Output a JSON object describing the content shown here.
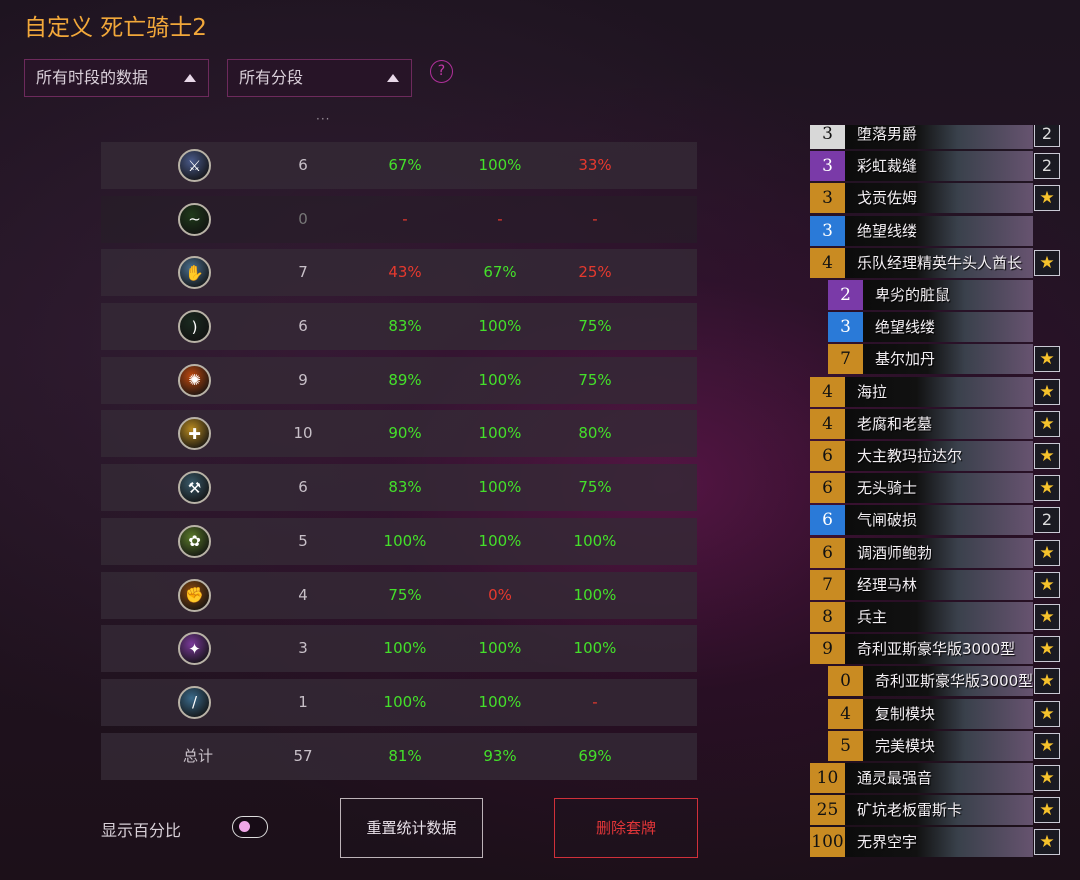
{
  "title": "自定义 死亡骑士2",
  "filters": {
    "time_label": "所有时段的数据",
    "rank_label": "所有分段",
    "help_label": "?"
  },
  "ellipsis": "···",
  "rows": [
    {
      "icon": "crossed-swords-icon",
      "games": "6",
      "w1": "67%",
      "w2": "100%",
      "w3": "33%",
      "c1": "green",
      "c2": "green",
      "c3": "red",
      "icolor": "#4a5a8a"
    },
    {
      "icon": "green-serpent-icon",
      "games": "0",
      "w1": "-",
      "w2": "-",
      "w3": "-",
      "c1": "red",
      "c2": "red",
      "c3": "red",
      "icolor": "#1f3a1a",
      "empty": true
    },
    {
      "icon": "claw-icon",
      "games": "7",
      "w1": "43%",
      "w2": "67%",
      "w3": "25%",
      "c1": "red",
      "c2": "green",
      "c3": "red",
      "icolor": "#4a7090"
    },
    {
      "icon": "bow-icon",
      "games": "6",
      "w1": "83%",
      "w2": "100%",
      "w3": "75%",
      "c1": "green",
      "c2": "green",
      "c3": "green",
      "icolor": "#1a2a20"
    },
    {
      "icon": "fire-icon",
      "games": "9",
      "w1": "89%",
      "w2": "100%",
      "w3": "75%",
      "c1": "green",
      "c2": "green",
      "c3": "green",
      "icolor": "#c04a10"
    },
    {
      "icon": "holy-tome-icon",
      "games": "10",
      "w1": "90%",
      "w2": "100%",
      "w3": "80%",
      "c1": "green",
      "c2": "green",
      "c3": "green",
      "icolor": "#b88a20"
    },
    {
      "icon": "hammer-icon",
      "games": "6",
      "w1": "83%",
      "w2": "100%",
      "w3": "75%",
      "c1": "green",
      "c2": "green",
      "c3": "green",
      "icolor": "#3a5a6a"
    },
    {
      "icon": "nature-icon",
      "games": "5",
      "w1": "100%",
      "w2": "100%",
      "w3": "100%",
      "c1": "green",
      "c2": "green",
      "c3": "green",
      "icolor": "#5a7a2a"
    },
    {
      "icon": "orc-fist-icon",
      "games": "4",
      "w1": "75%",
      "w2": "0%",
      "w3": "100%",
      "c1": "green",
      "c2": "red",
      "c3": "green",
      "icolor": "#8a4a10"
    },
    {
      "icon": "arcane-icon",
      "games": "3",
      "w1": "100%",
      "w2": "100%",
      "w3": "100%",
      "c1": "green",
      "c2": "green",
      "c3": "green",
      "icolor": "#7a3a9a"
    },
    {
      "icon": "sword-icon",
      "games": "1",
      "w1": "100%",
      "w2": "100%",
      "w3": "-",
      "c1": "green",
      "c2": "green",
      "c3": "red",
      "icolor": "#3a6a8a"
    }
  ],
  "total": {
    "label": "总计",
    "games": "57",
    "w1": "81%",
    "w2": "93%",
    "w3": "69%"
  },
  "bottom": {
    "show_percent_label": "显示百分比",
    "reset_label": "重置统计数据",
    "delete_label": "删除套牌"
  },
  "cards": [
    {
      "cost": "3",
      "name": "堕落男爵",
      "badge": "2",
      "ccolor": "white",
      "sub": false
    },
    {
      "cost": "3",
      "name": "彩虹裁缝",
      "badge": "2",
      "ccolor": "purple",
      "sub": false
    },
    {
      "cost": "3",
      "name": "戈贡佐姆",
      "badge": "★",
      "ccolor": "gold",
      "sub": false
    },
    {
      "cost": "3",
      "name": "绝望线缕",
      "badge": "",
      "ccolor": "blue",
      "sub": false
    },
    {
      "cost": "4",
      "name": "乐队经理精英牛头人酋长",
      "badge": "★",
      "ccolor": "gold",
      "sub": false
    },
    {
      "cost": "2",
      "name": "卑劣的脏鼠",
      "badge": "",
      "ccolor": "purple",
      "sub": true
    },
    {
      "cost": "3",
      "name": "绝望线缕",
      "badge": "",
      "ccolor": "blue",
      "sub": true
    },
    {
      "cost": "7",
      "name": "基尔加丹",
      "badge": "★",
      "ccolor": "gold",
      "sub": true
    },
    {
      "cost": "4",
      "name": "海拉",
      "badge": "★",
      "ccolor": "gold",
      "sub": false
    },
    {
      "cost": "4",
      "name": "老腐和老墓",
      "badge": "★",
      "ccolor": "gold",
      "sub": false
    },
    {
      "cost": "6",
      "name": "大主教玛拉达尔",
      "badge": "★",
      "ccolor": "gold",
      "sub": false
    },
    {
      "cost": "6",
      "name": "无头骑士",
      "badge": "★",
      "ccolor": "gold",
      "sub": false
    },
    {
      "cost": "6",
      "name": "气闸破损",
      "badge": "2",
      "ccolor": "blue",
      "sub": false
    },
    {
      "cost": "6",
      "name": "调酒师鲍勃",
      "badge": "★",
      "ccolor": "gold",
      "sub": false
    },
    {
      "cost": "7",
      "name": "经理马林",
      "badge": "★",
      "ccolor": "gold",
      "sub": false
    },
    {
      "cost": "8",
      "name": "兵主",
      "badge": "★",
      "ccolor": "gold",
      "sub": false
    },
    {
      "cost": "9",
      "name": "奇利亚斯豪华版3000型",
      "badge": "★",
      "ccolor": "gold",
      "sub": false
    },
    {
      "cost": "0",
      "name": "奇利亚斯豪华版3000型",
      "badge": "★",
      "ccolor": "gold",
      "sub": true
    },
    {
      "cost": "4",
      "name": "复制模块",
      "badge": "★",
      "ccolor": "gold",
      "sub": true
    },
    {
      "cost": "5",
      "name": "完美模块",
      "badge": "★",
      "ccolor": "gold",
      "sub": true
    },
    {
      "cost": "10",
      "name": "通灵最强音",
      "badge": "★",
      "ccolor": "gold",
      "sub": false
    },
    {
      "cost": "25",
      "name": "矿坑老板雷斯卡",
      "badge": "★",
      "ccolor": "gold",
      "sub": false
    },
    {
      "cost": "100",
      "name": "无界空宇",
      "badge": "★",
      "ccolor": "gold",
      "sub": false
    }
  ]
}
